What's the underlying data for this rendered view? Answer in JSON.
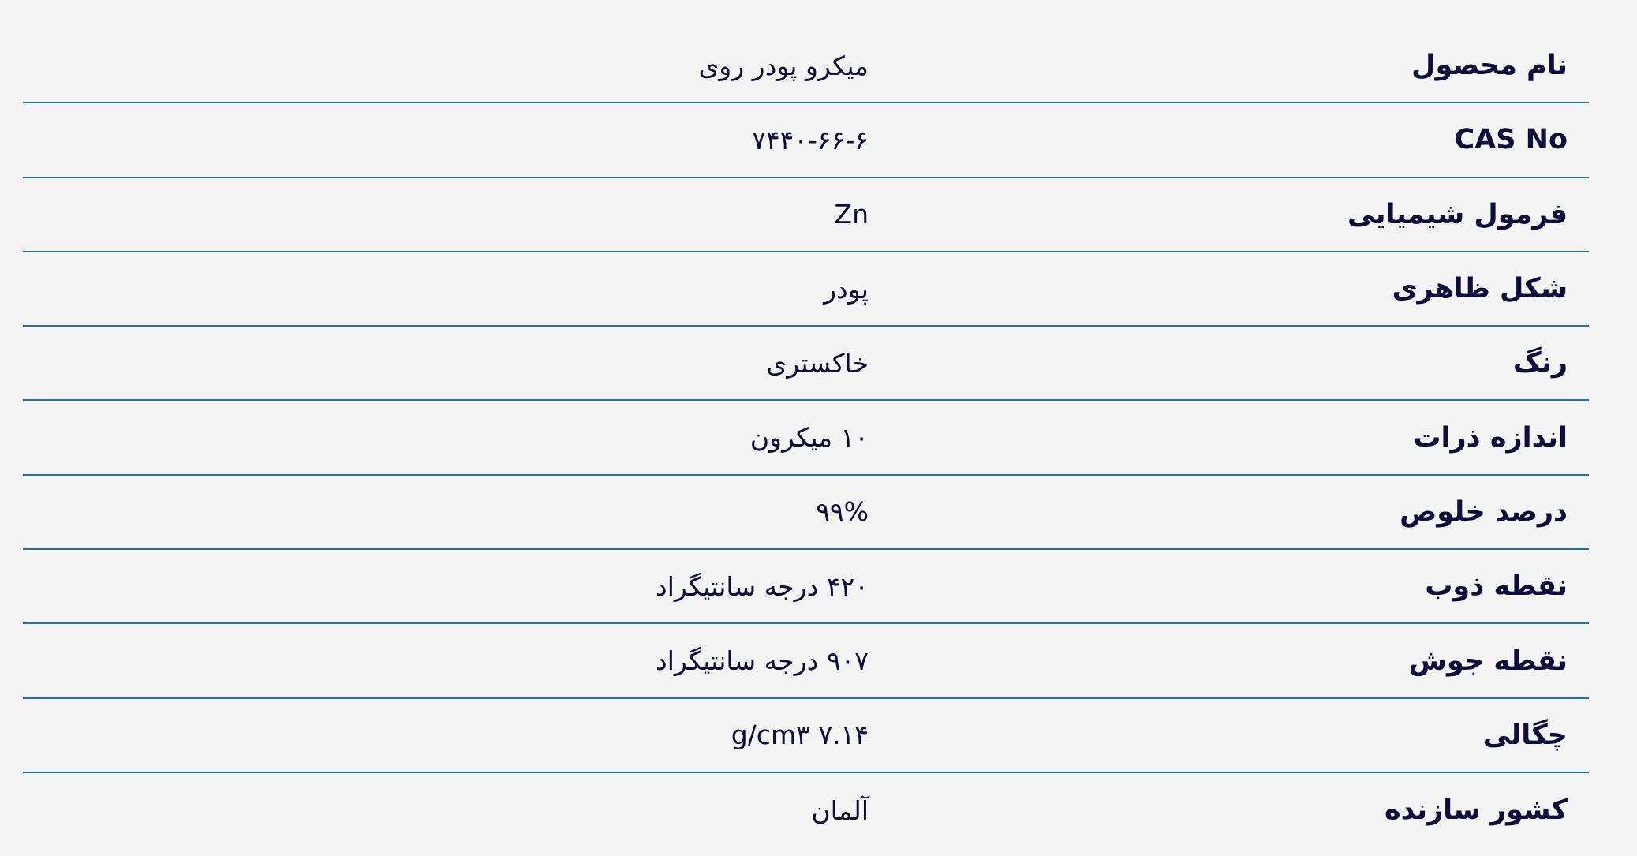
{
  "colors": {
    "text": "#0d0c3d",
    "divider": "#1e70c1",
    "background": "#f4f4f4"
  },
  "rows": [
    {
      "label": "نام محصول",
      "value": "میکرو پودر روی"
    },
    {
      "label": "CAS No",
      "value": "۷۴۴۰-۶۶-۶"
    },
    {
      "label": "فرمول شیمیایی",
      "value": "Zn"
    },
    {
      "label": "شکل ظاهری",
      "value": "پودر"
    },
    {
      "label": "رنگ",
      "value": "خاکستری"
    },
    {
      "label": "اندازه ذرات",
      "value": "۱۰ میکرون"
    },
    {
      "label": "درصد خلوص",
      "value": "۹۹%"
    },
    {
      "label": "نقطه ذوب",
      "value": "۴۲۰ درجه سانتیگراد"
    },
    {
      "label": "نقطه جوش",
      "value": "۹۰۷ درجه سانتیگراد"
    },
    {
      "label": "چگالی",
      "value": "۷.۱۴ g/cm۳"
    },
    {
      "label": "کشور سازنده",
      "value": "آلمان"
    }
  ]
}
